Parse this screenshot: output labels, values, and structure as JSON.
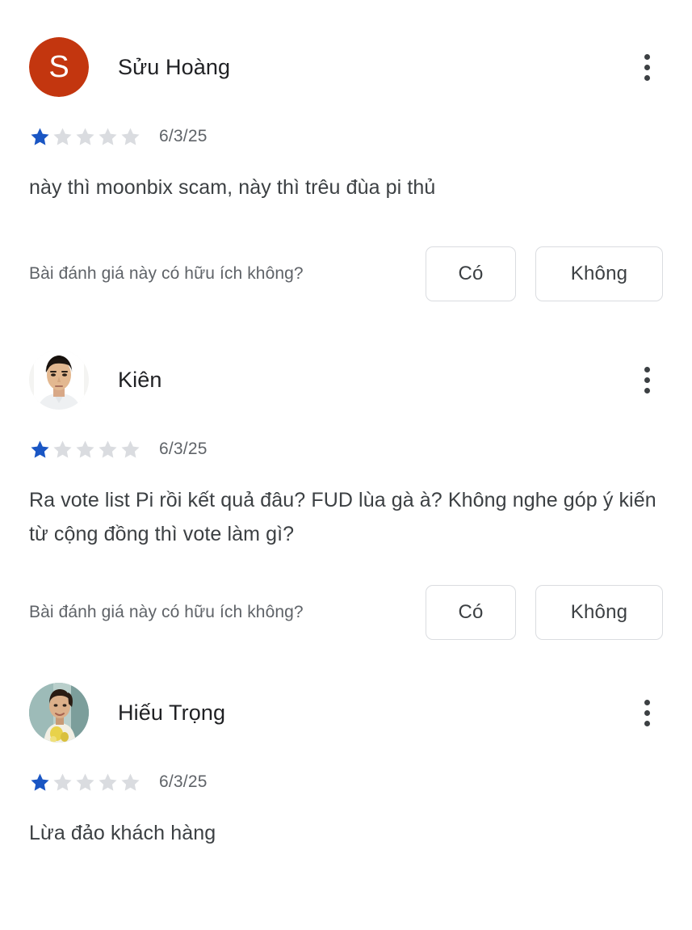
{
  "screen": {
    "name": "app-store-reviews-list",
    "background": "#ffffff",
    "star_filled_color": "#1a56c4",
    "star_empty_color": "#dadce0"
  },
  "labels": {
    "helpful_question": "Bài đánh giá này có hữu ích không?",
    "yes": "Có",
    "no": "Không"
  },
  "reviews": [
    {
      "author": "Sửu Hoàng",
      "avatar_type": "initial",
      "avatar_initial": "S",
      "avatar_color": "#c3360f",
      "rating": 1,
      "rating_max": 5,
      "date": "6/3/25",
      "text": "này thì moonbix scam, này thì trêu đùa pi thủ",
      "has_helpful_row": true
    },
    {
      "author": "Kiên",
      "avatar_type": "photo",
      "avatar_description": "man-portrait-photo",
      "rating": 1,
      "rating_max": 5,
      "date": "6/3/25",
      "text": "Ra vote list Pi rồi kết quả đâu? FUD lùa gà à? Không nghe góp ý kiến từ cộng đồng thì vote làm gì?",
      "has_helpful_row": true
    },
    {
      "author": "Hiếu Trọng",
      "avatar_type": "photo",
      "avatar_description": "child-portrait-photo",
      "rating": 1,
      "rating_max": 5,
      "date": "6/3/25",
      "text": "Lừa đảo khách hàng",
      "has_helpful_row": false
    }
  ]
}
